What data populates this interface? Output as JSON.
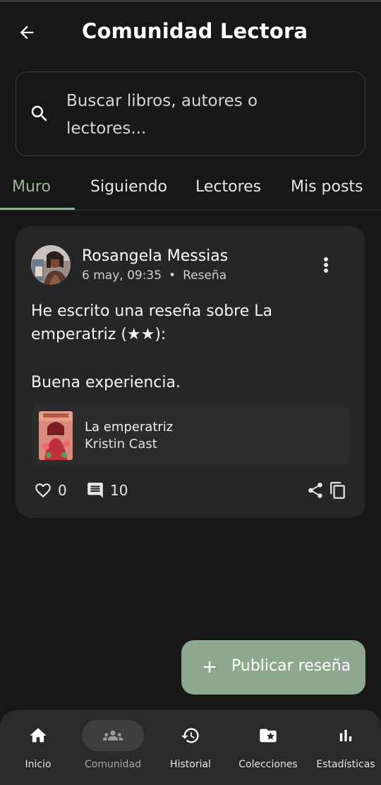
{
  "header": {
    "title": "Comunidad Lectora"
  },
  "search": {
    "placeholder": "Buscar libros, autores o lectores..."
  },
  "tabs": [
    {
      "label": "Muro",
      "active": true
    },
    {
      "label": "Siguiendo",
      "active": false
    },
    {
      "label": "Lectores",
      "active": false
    },
    {
      "label": "Mis posts",
      "active": false
    }
  ],
  "post": {
    "author": "Rosangela Messias",
    "date": "6 may, 09:35",
    "type": "Reseña",
    "text_line1": "He escrito una reseña sobre La emperatriz (★★):",
    "text_line2": "Buena experiencia.",
    "book": {
      "title": "La emperatriz",
      "author": "Kristin Cast"
    },
    "likes": "0",
    "comments": "10"
  },
  "fab": {
    "label": "Publicar reseña"
  },
  "bottom_nav": [
    {
      "label": "Inicio",
      "icon": "home-icon",
      "active": false
    },
    {
      "label": "Comunidad",
      "icon": "groups-icon",
      "active": true
    },
    {
      "label": "Historial",
      "icon": "history-icon",
      "active": false
    },
    {
      "label": "Colecciones",
      "icon": "folder-star-icon",
      "active": false
    },
    {
      "label": "Estadísticas",
      "icon": "bar-chart-icon",
      "active": false
    }
  ],
  "colors": {
    "background": "#171717",
    "card": "#262626",
    "accent": "#8ea88f",
    "active_tab": "#9cb59e"
  }
}
